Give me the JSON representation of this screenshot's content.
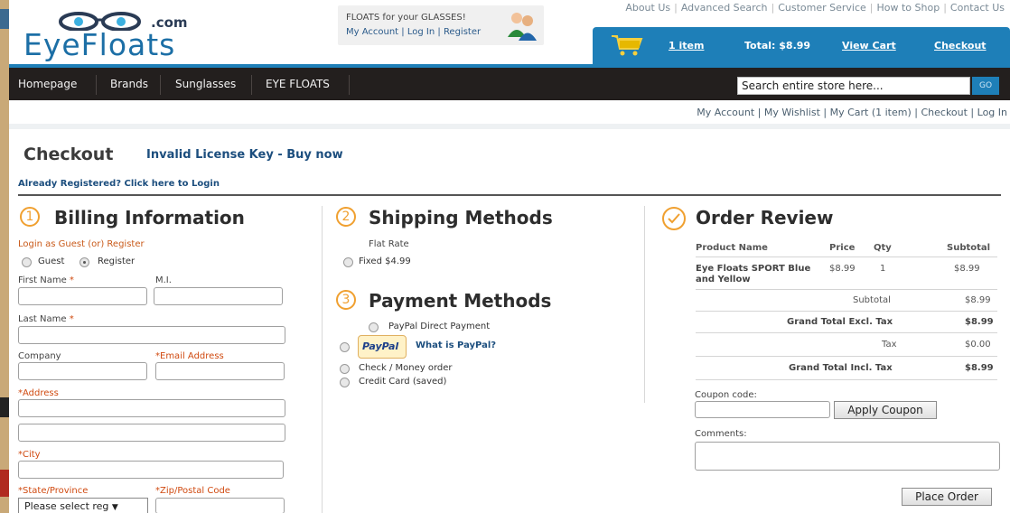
{
  "header": {
    "logo_dotcom": ".com",
    "logo_wordmark": "EyeFloats",
    "promo_line1": "FLOATS for your GLASSES!",
    "promo_my_account": "My Account",
    "promo_login": "Log In",
    "promo_register": "Register",
    "top_links": [
      "About Us",
      "Advanced Search",
      "Customer Service",
      "How to Shop",
      "Contact Us"
    ],
    "cart_items": "1 item",
    "cart_total": "Total: $8.99",
    "view_cart": "View Cart",
    "checkout": "Checkout"
  },
  "nav": {
    "items": [
      "Homepage",
      "Brands",
      "Sunglasses",
      "EYE FLOATS"
    ],
    "search_value": "Search entire store here...",
    "go": "GO"
  },
  "account_links": "My Account | My Wishlist | My Cart (1 item) | Checkout | Log In",
  "page": {
    "title": "Checkout",
    "license": "Invalid License Key - Buy now",
    "already_registered": "Already Registered? Click here to Login"
  },
  "billing": {
    "num": "1",
    "title": "Billing Information",
    "login_as": "Login as Guest (or) Register",
    "guest": "Guest",
    "register": "Register",
    "first_name": "First Name",
    "mi": "M.I.",
    "last_name": "Last Name",
    "company": "Company",
    "email": "*Email Address",
    "address": "*Address",
    "city": "*City",
    "state": "*State/Province",
    "zip": "*Zip/Postal Code",
    "state_select": "Please select reg",
    "star": "*"
  },
  "shipping": {
    "num": "2",
    "title": "Shipping Methods",
    "flat_rate": "Flat Rate",
    "fixed": "Fixed $4.99"
  },
  "payment": {
    "num": "3",
    "title": "Payment Methods",
    "paypal_direct": "PayPal Direct Payment",
    "paypal_logo": "PayPal",
    "what_is_paypal": "What is PayPal?",
    "check": "Check / Money order",
    "credit": "Credit Card (saved)"
  },
  "review": {
    "title": "Order Review",
    "headers": [
      "Product Name",
      "Price",
      "Qty",
      "Subtotal"
    ],
    "product_name_line1": "Eye Floats SPORT Blue",
    "product_name_line2": "and Yellow",
    "price": "$8.99",
    "qty": "1",
    "subtotal": "$8.99",
    "totals": [
      {
        "label": "Subtotal",
        "value": "$8.99"
      },
      {
        "label": "Grand Total Excl. Tax",
        "value": "$8.99"
      },
      {
        "label": "Tax",
        "value": "$0.00"
      },
      {
        "label": "Grand Total Incl. Tax",
        "value": "$8.99"
      }
    ],
    "coupon_label": "Coupon code:",
    "apply_coupon": "Apply Coupon",
    "comments_label": "Comments:",
    "place_order": "Place Order"
  }
}
